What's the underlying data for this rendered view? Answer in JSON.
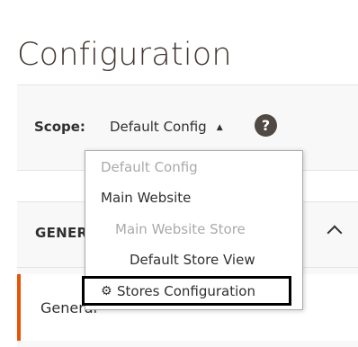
{
  "page": {
    "title": "Configuration"
  },
  "scope": {
    "label": "Scope:",
    "current": "Default Config",
    "help_symbol": "?",
    "dropdown": {
      "options": [
        {
          "label": "Default Config",
          "state": "disabled"
        },
        {
          "label": "Main Website",
          "state": "enabled"
        },
        {
          "label": "Main Website Store",
          "state": "disabled"
        },
        {
          "label": "Default Store View",
          "state": "enabled"
        }
      ],
      "action": {
        "icon": "gear-icon",
        "label": "Stores Configuration"
      }
    }
  },
  "sections": {
    "group_title": "GENERAL",
    "items": [
      {
        "label": "General",
        "active": true
      }
    ]
  },
  "colors": {
    "accent": "#eb5202",
    "help_icon_bg": "#514943",
    "disabled_text": "#aaaaaa",
    "panel_bg": "#f8f8f8"
  }
}
